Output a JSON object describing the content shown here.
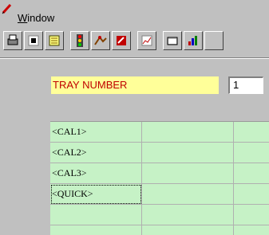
{
  "menu": {
    "window_label": "Window",
    "window_accel": "W",
    "window_rest": "indow"
  },
  "toolbar": {
    "buttons": [
      "printer-icon",
      "stop-icon",
      "list-icon",
      "traffic-light-icon",
      "run-icon",
      "tool-icon",
      "chart-line-icon",
      "folder-icon",
      "bar-chart-icon"
    ]
  },
  "form": {
    "tray_label": "TRAY NUMBER",
    "tray_value": "1"
  },
  "grid": {
    "rows": [
      {
        "name": "<CAL1>"
      },
      {
        "name": "<CAL2>"
      },
      {
        "name": "<CAL3>"
      },
      {
        "name": "<QUICK>"
      },
      {
        "name": ""
      },
      {
        "name": ""
      }
    ]
  },
  "colors": {
    "window_bg": "#c0c0c0",
    "label_bg": "#ffff99",
    "label_text": "#c00000",
    "grid_bg": "#c6f2c6"
  }
}
